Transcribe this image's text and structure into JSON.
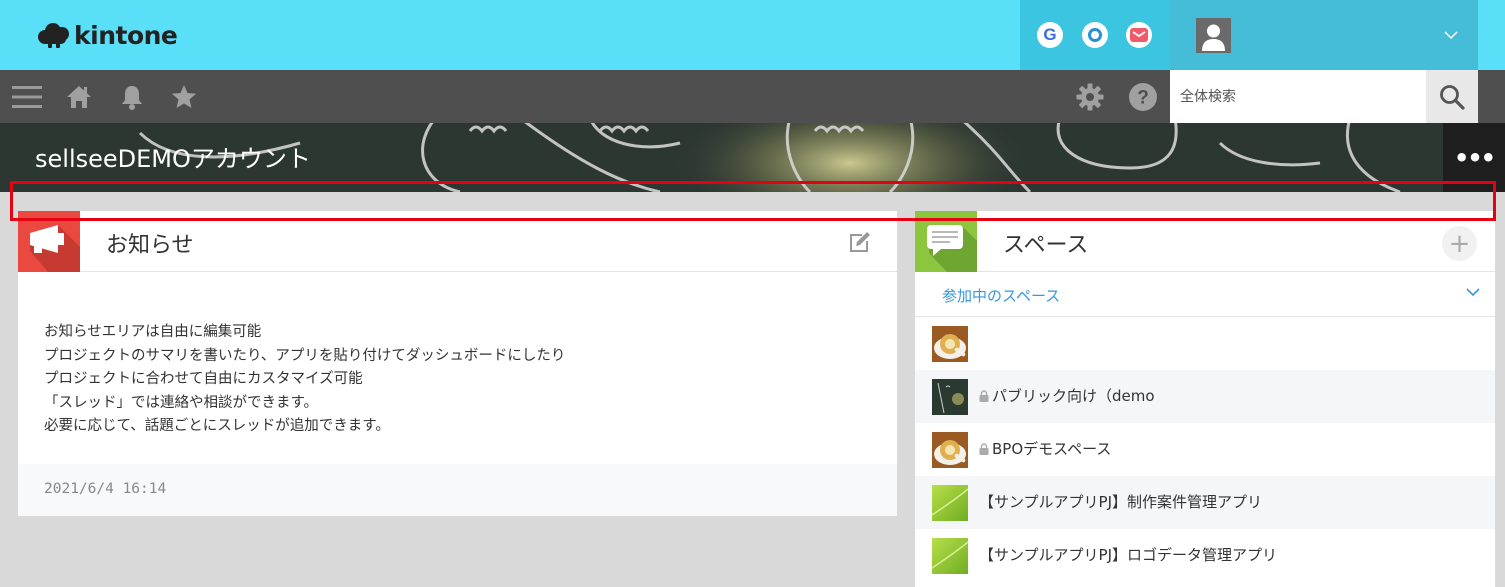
{
  "header": {
    "logo_text": "kintone",
    "apps": [
      {
        "name": "google",
        "glyph": "G",
        "color": "#3b6fd6"
      },
      {
        "name": "cybozu",
        "glyph": "◎",
        "color": "#2a90d8"
      },
      {
        "name": "mail",
        "glyph": "✉",
        "color": "#f15a6b"
      }
    ],
    "user_menu_glyph": "﹀"
  },
  "nav": {
    "search_placeholder": "全体検索"
  },
  "banner": {
    "title": "sellseeDEMOアカウント",
    "menu_glyph": "•••"
  },
  "notice": {
    "title": "お知らせ",
    "lines": [
      "お知らせエリアは自由に編集可能",
      "プロジェクトのサマリを書いたり、アプリを貼り付けてダッシュボードにしたり",
      "プロジェクトに合わせて自由にカスタマイズ可能",
      "「スレッド」では連絡や相談ができます。",
      "必要に応じて、話題ごとにスレッドが追加できます。"
    ],
    "date": "2021/6/4 16:14"
  },
  "space": {
    "title": "スペース",
    "add_glyph": "+",
    "tab_label": "参加中のスペース",
    "items": [
      {
        "name": "",
        "locked": false,
        "thumb": "coffee"
      },
      {
        "name": "パブリック向け（demo",
        "locked": true,
        "thumb": "dark"
      },
      {
        "name": "BPOデモスペース",
        "locked": true,
        "thumb": "coffee"
      },
      {
        "name": "【サンプルアプリPJ】制作案件管理アプリ",
        "locked": false,
        "thumb": "green"
      },
      {
        "name": "【サンプルアプリPJ】ロゴデータ管理アプリ",
        "locked": false,
        "thumb": "green"
      }
    ]
  }
}
